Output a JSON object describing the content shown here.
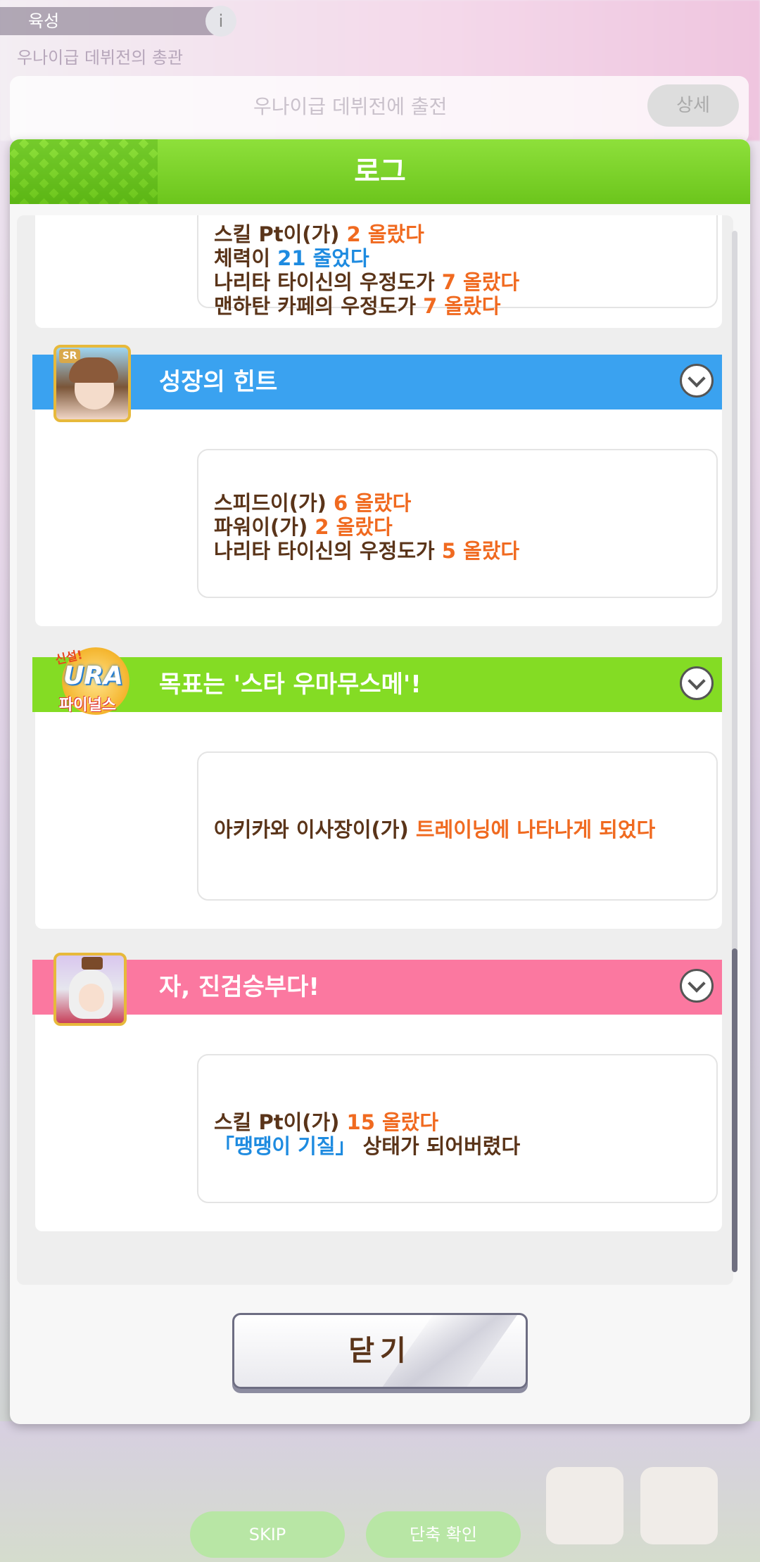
{
  "background": {
    "top_label": "육성",
    "info_icon": "info-icon",
    "sub_label": "우나이급 데뷔전의 총관",
    "card_text": "우나이급 데뷔전에 출전",
    "card_button": "상세",
    "bottom_buttons": [
      "SKIP",
      "단축 확인"
    ]
  },
  "modal": {
    "title": "로그",
    "close_label": "닫기"
  },
  "entries": [
    {
      "title": "",
      "lines": [
        [
          {
            "t": "스킬 Pt이(가) ",
            "c": "n"
          },
          {
            "t": "2 올랐다",
            "c": "o"
          }
        ],
        [
          {
            "t": "체력이 ",
            "c": "n"
          },
          {
            "t": "21 줄었다",
            "c": "b"
          }
        ],
        [
          {
            "t": "나리타 타이신의 우정도가 ",
            "c": "n"
          },
          {
            "t": "7 올랐다",
            "c": "o"
          }
        ],
        [
          {
            "t": "맨하탄 카페의 우정도가 ",
            "c": "n"
          },
          {
            "t": "7 올랐다",
            "c": "o"
          }
        ]
      ]
    },
    {
      "title": "성장의 힌트",
      "header_color": "#3aa2f0",
      "avatar_badge": "SR",
      "lines": [
        [
          {
            "t": "스피드이(가) ",
            "c": "n"
          },
          {
            "t": "6 올랐다",
            "c": "o"
          }
        ],
        [
          {
            "t": "파워이(가) ",
            "c": "n"
          },
          {
            "t": "2 올랐다",
            "c": "o"
          }
        ],
        [
          {
            "t": "나리타 타이신의 우정도가 ",
            "c": "n"
          },
          {
            "t": "5 올랐다",
            "c": "o"
          }
        ]
      ]
    },
    {
      "title": "목표는 '스타 우마무스메'!",
      "header_color": "#84dc24",
      "logo": {
        "top": "신설!",
        "mid": "URA",
        "bottom": "파이널스"
      },
      "lines": [
        [
          {
            "t": "아키카와 이사장이(가) ",
            "c": "n"
          },
          {
            "t": "트레이닝에 나타나게 되었다",
            "c": "o"
          }
        ]
      ]
    },
    {
      "title": "자, 진검승부다!",
      "header_color": "#fb78a0",
      "lines": [
        [
          {
            "t": "스킬 Pt이(가) ",
            "c": "n"
          },
          {
            "t": "15 올랐다",
            "c": "o"
          }
        ],
        [
          {
            "t": "「땡땡이 기질」",
            "c": "b"
          },
          {
            "t": " 상태가 되어버렸다",
            "c": "n"
          }
        ]
      ]
    }
  ],
  "colors": {
    "header_green": "#6cc51c",
    "text_brown": "#5a3419",
    "value_orange": "#f06a20",
    "value_blue": "#1e8be0"
  }
}
